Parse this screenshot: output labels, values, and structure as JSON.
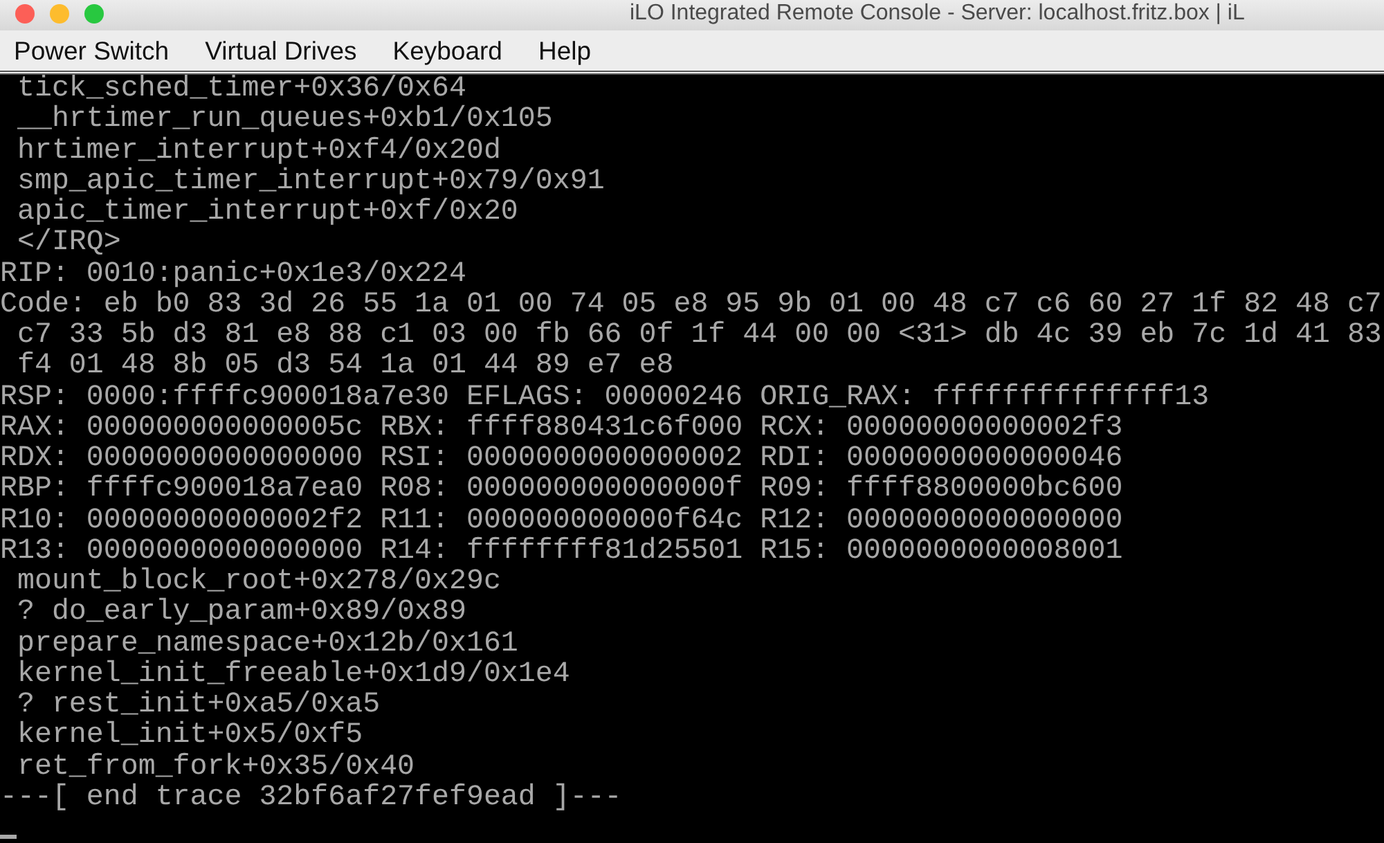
{
  "window": {
    "title": "iLO Integrated Remote Console - Server: localhost.fritz.box | iL"
  },
  "menu_bar": [
    "Power Switch",
    "Virtual Drives",
    "Keyboard",
    "Help"
  ],
  "console": {
    "lines": [
      " tick_sched_timer+0x36/0x64",
      " __hrtimer_run_queues+0xb1/0x105",
      " hrtimer_interrupt+0xf4/0x20d",
      " smp_apic_timer_interrupt+0x79/0x91",
      " apic_timer_interrupt+0xf/0x20",
      " </IRQ>",
      "RIP: 0010:panic+0x1e3/0x224",
      "Code: eb b0 83 3d 26 55 1a 01 00 74 05 e8 95 9b 01 00 48 c7 c6 60 27 1f 82 48 c7",
      " c7 33 5b d3 81 e8 88 c1 03 00 fb 66 0f 1f 44 00 00 <31> db 4c 39 eb 7c 1d 41 83",
      " f4 01 48 8b 05 d3 54 1a 01 44 89 e7 e8",
      "RSP: 0000:ffffc900018a7e30 EFLAGS: 00000246 ORIG_RAX: ffffffffffffff13",
      "RAX: 000000000000005c RBX: ffff880431c6f000 RCX: 00000000000002f3",
      "RDX: 0000000000000000 RSI: 0000000000000002 RDI: 0000000000000046",
      "RBP: ffffc900018a7ea0 R08: 000000000000000f R09: ffff8800000bc600",
      "R10: 00000000000002f2 R11: 000000000000f64c R12: 0000000000000000",
      "R13: 0000000000000000 R14: ffffffff81d25501 R15: 0000000000008001",
      " mount_block_root+0x278/0x29c",
      " ? do_early_param+0x89/0x89",
      " prepare_namespace+0x12b/0x161",
      " kernel_init_freeable+0x1d9/0x1e4",
      " ? rest_init+0xa5/0xa5",
      " kernel_init+0x5/0xf5",
      " ret_from_fork+0x35/0x40",
      "---[ end trace 32bf6af27fef9ead ]---"
    ]
  }
}
